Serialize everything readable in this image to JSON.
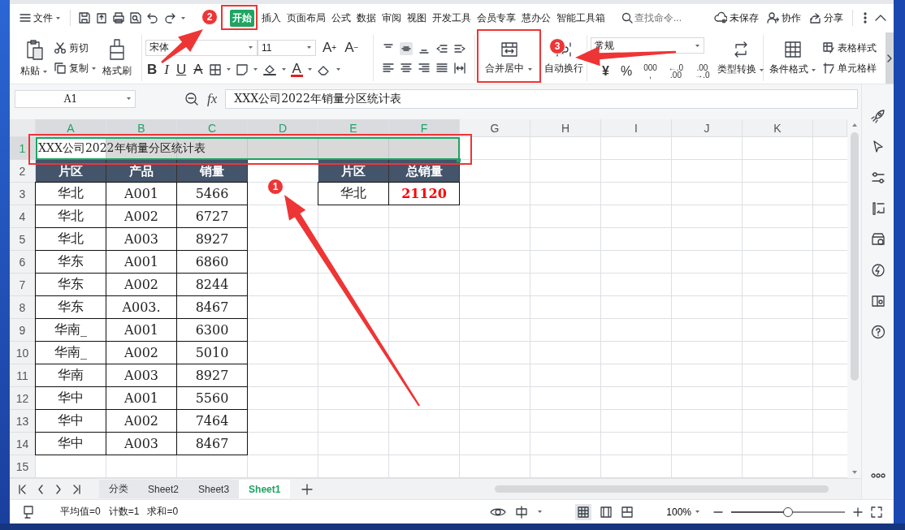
{
  "menu_bar": {
    "file": "文件",
    "tabs": [
      {
        "label": "开始",
        "selected": true
      },
      {
        "label": "插入",
        "selected": false
      },
      {
        "label": "页面布局",
        "selected": false
      },
      {
        "label": "公式",
        "selected": false
      },
      {
        "label": "数据",
        "selected": false
      },
      {
        "label": "审阅",
        "selected": false
      },
      {
        "label": "视图",
        "selected": false
      },
      {
        "label": "开发工具",
        "selected": false
      },
      {
        "label": "会员专享",
        "selected": false
      },
      {
        "label": "慧办公",
        "selected": false
      },
      {
        "label": "智能工具箱",
        "selected": false
      }
    ],
    "search": {
      "placeholder": "查找命令..."
    },
    "actions": [
      {
        "kind": "cloud",
        "label": "未保存"
      },
      {
        "kind": "collab",
        "label": "协作"
      },
      {
        "kind": "share",
        "label": "分享"
      }
    ]
  },
  "ribbon": {
    "paste": "粘贴",
    "cut": "剪切",
    "copy": "复制",
    "format_painter": "格式刷",
    "font_name": "宋体",
    "font_size": "11",
    "font_grow": {
      "label": "A",
      "sign": "+"
    },
    "font_shrink": {
      "label": "A",
      "sign": "−"
    },
    "font_styles": [
      {
        "kind": "bold",
        "label": "B"
      },
      {
        "kind": "italic",
        "label": "I"
      },
      {
        "kind": "underline",
        "label": "U"
      },
      {
        "kind": "strike",
        "label": "A"
      }
    ],
    "font_color": "A",
    "merge_center": "合并居中",
    "wrap_text": "自动换行",
    "number_format": "常规",
    "number_buttons": [
      {
        "kind": "currency",
        "lines": [
          "¥"
        ]
      },
      {
        "kind": "percent",
        "lines": [
          "%"
        ]
      },
      {
        "kind": "thousands",
        "lines": [
          "000",
          ","
        ]
      },
      {
        "kind": "decimal",
        "lines": [
          "←.0",
          ".00"
        ]
      },
      {
        "kind": "decimal",
        "lines": [
          ".00",
          "→.0"
        ]
      }
    ],
    "type_convert": "类型转换",
    "conditional_format": "条件格式",
    "table_style": "表格样式",
    "cell_style": "单元格样"
  },
  "formula_bar": {
    "cell": "A1",
    "fx": "fx",
    "value": "XXX公司2022年销量分区统计表"
  },
  "grid": {
    "columns": [
      {
        "label": "A",
        "selected": true
      },
      {
        "label": "B",
        "selected": true
      },
      {
        "label": "C",
        "selected": true
      },
      {
        "label": "D",
        "selected": true
      },
      {
        "label": "E",
        "selected": true
      },
      {
        "label": "F",
        "selected": true
      },
      {
        "label": "G",
        "selected": false
      },
      {
        "label": "H",
        "selected": false
      },
      {
        "label": "I",
        "selected": false
      },
      {
        "label": "J",
        "selected": false
      },
      {
        "label": "K",
        "selected": false
      }
    ],
    "rows": [
      {
        "label": "1",
        "selected": true,
        "cells": [
          {
            "kind": "title",
            "text": "XXX公司2022年销量分区统计表"
          },
          {
            "kind": "empty"
          },
          {
            "kind": "empty"
          }
        ]
      },
      {
        "label": "2",
        "selected": false,
        "cells": [
          {
            "kind": "header",
            "text": "片区"
          },
          {
            "kind": "header",
            "text": "产品"
          },
          {
            "kind": "header",
            "text": "销量"
          },
          {
            "kind": "empty"
          },
          {
            "kind": "header",
            "text": "片区"
          },
          {
            "kind": "header",
            "text": "总销量"
          }
        ]
      },
      {
        "label": "3",
        "selected": false,
        "cells": [
          {
            "kind": "data",
            "text": "华北"
          },
          {
            "kind": "data",
            "text": "A001"
          },
          {
            "kind": "data",
            "text": "5466"
          },
          {
            "kind": "empty"
          },
          {
            "kind": "data",
            "text": "华北"
          },
          {
            "kind": "total",
            "text": "21120"
          }
        ]
      },
      {
        "label": "4",
        "selected": false,
        "cells": [
          {
            "kind": "data",
            "text": "华北"
          },
          {
            "kind": "data",
            "text": "A002"
          },
          {
            "kind": "data",
            "text": "6727"
          }
        ]
      },
      {
        "label": "5",
        "selected": false,
        "cells": [
          {
            "kind": "data",
            "text": "华北"
          },
          {
            "kind": "data",
            "text": "A003"
          },
          {
            "kind": "data",
            "text": "8927"
          }
        ]
      },
      {
        "label": "6",
        "selected": false,
        "cells": [
          {
            "kind": "data",
            "text": "华东"
          },
          {
            "kind": "data",
            "text": "A001"
          },
          {
            "kind": "data",
            "text": "6860"
          }
        ]
      },
      {
        "label": "7",
        "selected": false,
        "cells": [
          {
            "kind": "data",
            "text": "华东"
          },
          {
            "kind": "data",
            "text": "A002"
          },
          {
            "kind": "data",
            "text": "8244"
          }
        ]
      },
      {
        "label": "8",
        "selected": false,
        "cells": [
          {
            "kind": "data",
            "text": "华东"
          },
          {
            "kind": "data",
            "text": "A003."
          },
          {
            "kind": "data",
            "text": "8467"
          }
        ]
      },
      {
        "label": "9",
        "selected": false,
        "cells": [
          {
            "kind": "data",
            "text": "华南_"
          },
          {
            "kind": "data",
            "text": "A001"
          },
          {
            "kind": "data",
            "text": "6300"
          }
        ]
      },
      {
        "label": "10",
        "selected": false,
        "cells": [
          {
            "kind": "data",
            "text": "华南_"
          },
          {
            "kind": "data",
            "text": "A002"
          },
          {
            "kind": "data",
            "text": "5010"
          }
        ]
      },
      {
        "label": "11",
        "selected": false,
        "cells": [
          {
            "kind": "data",
            "text": "华南"
          },
          {
            "kind": "data",
            "text": "A003"
          },
          {
            "kind": "data",
            "text": "8927"
          }
        ]
      },
      {
        "label": "12",
        "selected": false,
        "cells": [
          {
            "kind": "data",
            "text": "华中"
          },
          {
            "kind": "data",
            "text": "A001"
          },
          {
            "kind": "data",
            "text": "5560"
          }
        ]
      },
      {
        "label": "13",
        "selected": false,
        "cells": [
          {
            "kind": "data",
            "text": "华中"
          },
          {
            "kind": "data",
            "text": "A002"
          },
          {
            "kind": "data",
            "text": "7464"
          }
        ]
      },
      {
        "label": "14",
        "selected": false,
        "cells": [
          {
            "kind": "data",
            "text": "华中"
          },
          {
            "kind": "data",
            "text": "A003"
          },
          {
            "kind": "data",
            "text": "8467"
          }
        ]
      },
      {
        "label": "15",
        "selected": false,
        "cells": []
      }
    ]
  },
  "sheet_tabs": [
    {
      "label": "分类",
      "selected": false
    },
    {
      "label": "Sheet2",
      "selected": false
    },
    {
      "label": "Sheet3",
      "selected": false
    },
    {
      "label": "Sheet1",
      "selected": true
    }
  ],
  "status_bar": {
    "stats": [
      "平均值=0",
      "计数=1",
      "求和=0"
    ],
    "zoom": "100%",
    "zoom_slider": {
      "level": 0.5
    }
  },
  "annotations": {
    "badges": [
      "1",
      "2",
      "3"
    ]
  }
}
